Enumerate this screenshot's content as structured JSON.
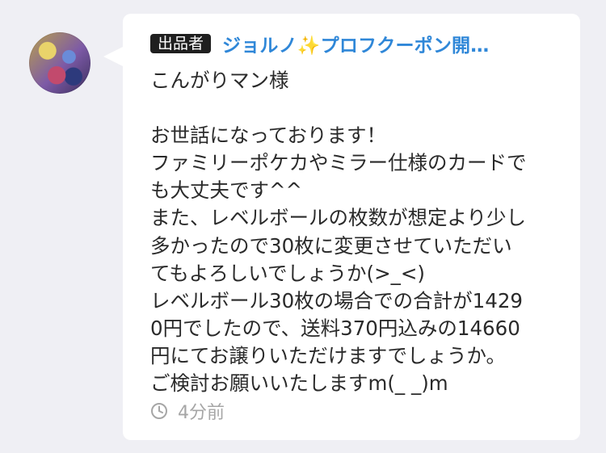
{
  "seller": {
    "badge": "出品者",
    "name": "ジョルノ✨プロフクーポン開…"
  },
  "message": {
    "lines": [
      "こんがりマン様",
      "",
      "お世話になっております！",
      "ファミリーポケカやミラー仕様のカードで",
      "も大丈夫です^^",
      "また、レベルボールの枚数が想定より少し",
      "多かったので30枚に変更させていただい",
      "てもよろしいでしょうか(>_<)",
      "レベルボール30枚の場合での合計が1429",
      "0円でしたので、送料370円込みの14660",
      "円にてお譲りいただけますでしょうか。",
      "ご検討お願いいたしますm(_ _)m"
    ]
  },
  "footer": {
    "icon": "clock-icon",
    "timestamp": "4分前"
  },
  "colors": {
    "background": "#efeff4",
    "bubble": "#ffffff",
    "name_link": "#2f87d8",
    "badge_bg": "#1f1f1f",
    "text": "#2a2a2a",
    "meta": "#a6a6a6"
  }
}
